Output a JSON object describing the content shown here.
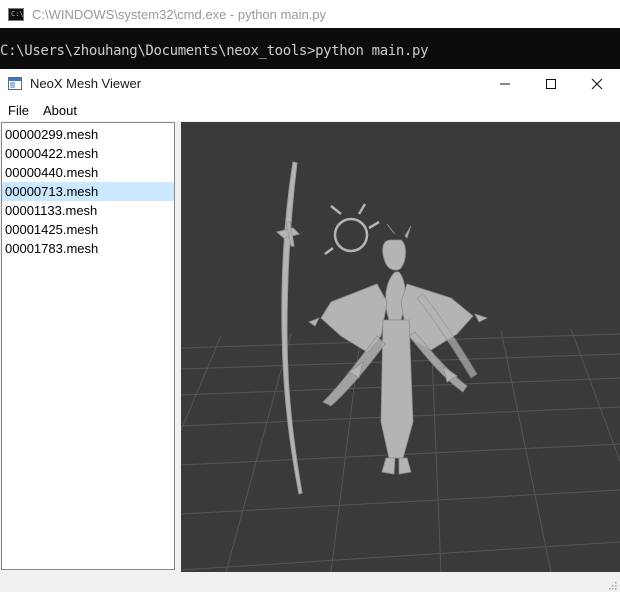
{
  "console": {
    "title": "C:\\WINDOWS\\system32\\cmd.exe - python  main.py",
    "icon": "cmd-icon",
    "prompt_line": "C:\\Users\\zhouhang\\Documents\\neox_tools>python main.py"
  },
  "app": {
    "title": "NeoX Mesh Viewer",
    "icon": "app-window-icon",
    "controls": {
      "minimize": "minimize-icon",
      "maximize": "maximize-icon",
      "close": "close-icon"
    },
    "menu": [
      {
        "label": "File"
      },
      {
        "label": "About"
      }
    ],
    "files": [
      {
        "name": "00000299.mesh",
        "selected": false
      },
      {
        "name": "00000422.mesh",
        "selected": false
      },
      {
        "name": "00000440.mesh",
        "selected": false
      },
      {
        "name": "00000713.mesh",
        "selected": true
      },
      {
        "name": "00001133.mesh",
        "selected": false
      },
      {
        "name": "00001425.mesh",
        "selected": false
      },
      {
        "name": "00001783.mesh",
        "selected": false
      }
    ],
    "viewport": {
      "background": "#3a3a3a",
      "grid_color": "#555555",
      "model_color": "#b4b4b4"
    },
    "selection_color": "#cce8ff"
  }
}
